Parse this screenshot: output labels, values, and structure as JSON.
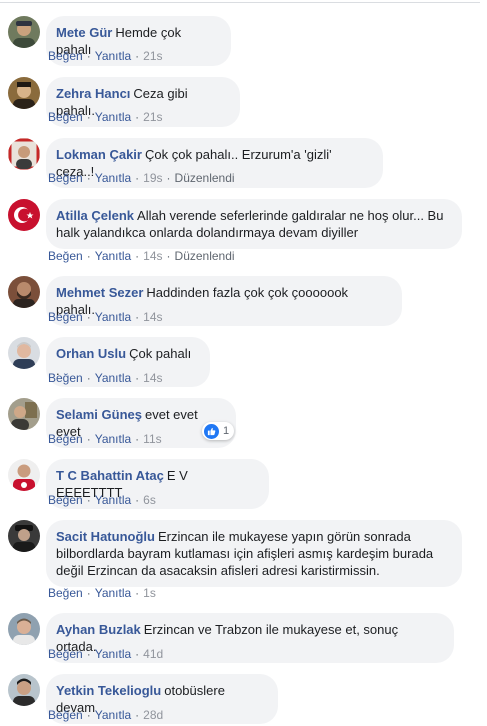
{
  "labels": {
    "like": "Beğen",
    "reply": "Yanıtla",
    "edited": "Düzenlendi"
  },
  "comments": [
    {
      "author": "Mete Gür",
      "text": "Hemde çok pahalı",
      "time": "21s",
      "edited": false,
      "avatar": "person-with-cap"
    },
    {
      "author": "Zehra Hancı",
      "text": "Ceza gibi pahalı.",
      "time": "21s",
      "edited": false,
      "avatar": "historical-portrait"
    },
    {
      "author": "Lokman Çakir",
      "text": "Çok çok pahalı.. Erzurum'a 'gizli' ceza..!",
      "time": "19s",
      "edited": true,
      "avatar": "portrait-red-frame"
    },
    {
      "author": "Atilla Çelenk",
      "text": "Allah verende seferlerinde galdıralar ne hoş olur... Bu halk yalandıkca onlarda dolandırmaya devam diyiller",
      "time": "14s",
      "edited": true,
      "avatar": "turkish-flag-crescent"
    },
    {
      "author": "Mehmet Sezer",
      "text": "Haddinden fazla çok çok çooooook pahalı.",
      "time": "14s",
      "edited": false,
      "avatar": "bearded-man"
    },
    {
      "author": "Orhan Uslu",
      "text": "Çok pahalı .",
      "time": "14s",
      "edited": false,
      "avatar": "grey-haired-man"
    },
    {
      "author": "Selami Güneş",
      "text": "evet evet evet",
      "time": "11s",
      "edited": false,
      "avatar": "man-with-frame",
      "reaction_count": "1"
    },
    {
      "author": "T C Bahattin Ataç",
      "text": "E V EEEETTTT",
      "time": "6s",
      "edited": false,
      "avatar": "man-red-badge"
    },
    {
      "author": "Sacit Hatunoğlu",
      "text": "Erzincan ile mukayese yapın görün sonrada bilbordlarda bayram kutlaması için afişleri asmış kardeşim burada değil Erzincan da asacaksin afisleri adresi karistirmissin.",
      "time": "1s",
      "edited": false,
      "avatar": "man-with-hat"
    },
    {
      "author": "Ayhan Buzlak",
      "text": "Erzincan ve Trabzon ile mukayese et, sonuç ortada.",
      "time": "41d",
      "edited": false,
      "avatar": "man-outdoor"
    },
    {
      "author": "Yetkin Tekelioglu",
      "text": "otobüslere devam",
      "time": "28d",
      "edited": false,
      "avatar": "man-dark-hair"
    }
  ],
  "colors": {
    "author": "#385898",
    "bubble": "#f2f3f5",
    "meta": "#606770",
    "like_blue": "#2078f4"
  }
}
